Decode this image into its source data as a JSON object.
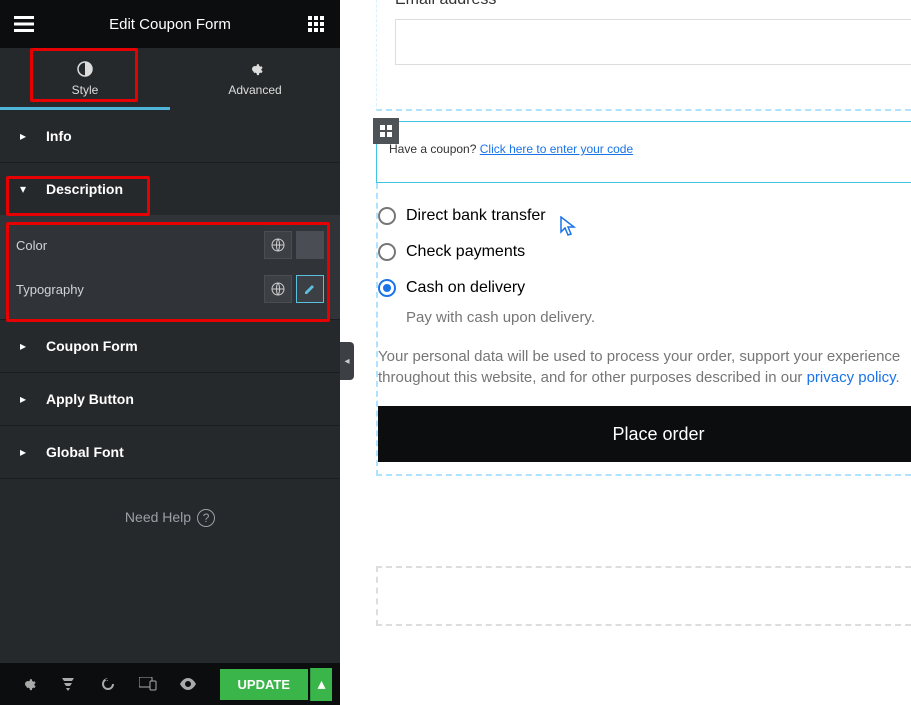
{
  "header": {
    "title": "Edit Coupon Form"
  },
  "tabs": {
    "style": "Style",
    "advanced": "Advanced"
  },
  "sections": {
    "info": "Info",
    "description": "Description",
    "coupon_form": "Coupon Form",
    "apply_button": "Apply Button",
    "global_font": "Global Font"
  },
  "description_props": {
    "color_label": "Color",
    "typography_label": "Typography"
  },
  "help": "Need Help",
  "footer": {
    "update": "UPDATE"
  },
  "preview": {
    "email_label": "Email address *",
    "coupon_question": "Have a coupon? ",
    "coupon_link": "Click here to enter your code",
    "payment_options": {
      "bank": "Direct bank transfer",
      "check": "Check payments",
      "cod": "Cash on delivery"
    },
    "cod_hint": "Pay with cash upon delivery.",
    "privacy_text_1": "Your personal data will be used to process your order, support your experience throughout this website, and for other purposes described in our ",
    "privacy_link": "privacy policy",
    "privacy_text_2": ".",
    "place_order": "Place order"
  }
}
